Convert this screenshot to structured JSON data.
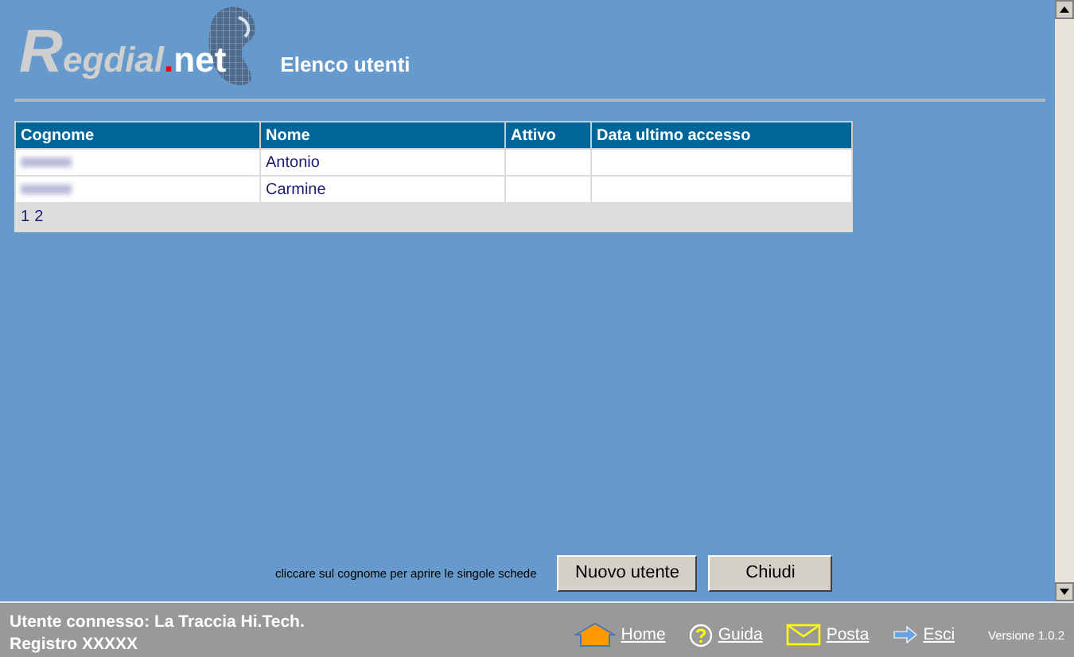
{
  "logo": {
    "name": "Regdial",
    "separator": ".",
    "suffix": "net"
  },
  "title": "Elenco utenti",
  "table": {
    "columns": [
      "Cognome",
      "Nome",
      "Attivo",
      "Data ultimo accesso"
    ],
    "rows": [
      {
        "surname_redacted": true,
        "nome": "Antonio"
      },
      {
        "surname_redacted": true,
        "nome": "Carmine"
      }
    ],
    "pages": [
      "1",
      "2"
    ]
  },
  "hint": "cliccare sul cognome per aprire le singole schede",
  "buttons": [
    "Nuovo utente",
    "Chiudi"
  ],
  "status_bar": {
    "user": "Utente connesso: La Traccia Hi.Tech.",
    "registry": "Registro XXXXX",
    "links": [
      {
        "kind": "home",
        "label": "Home"
      },
      {
        "kind": "help",
        "label": "Guida"
      },
      {
        "kind": "mail",
        "label": "Posta"
      },
      {
        "kind": "exit",
        "label": "Esci"
      }
    ],
    "version": "Versione 1.0.2"
  }
}
